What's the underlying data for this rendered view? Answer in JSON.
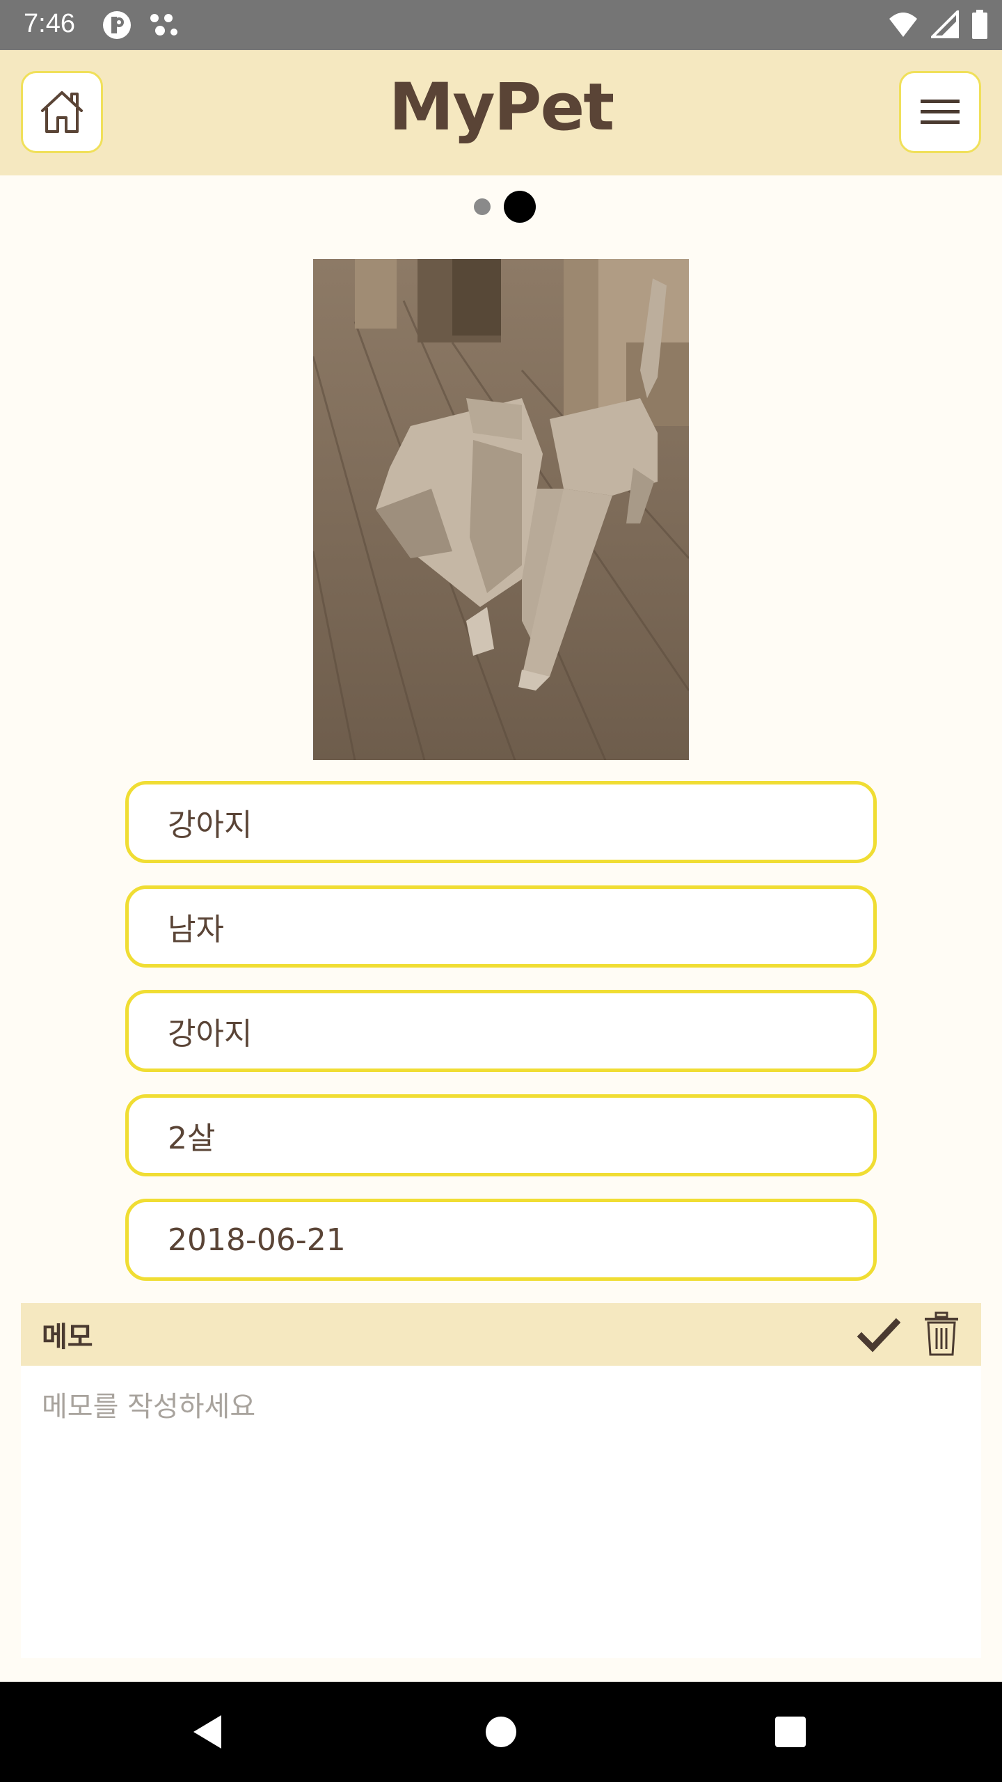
{
  "status_bar": {
    "time": "7:46",
    "left_icons": [
      "p-badge-icon",
      "dots-icon"
    ],
    "right_icons": [
      "wifi-icon",
      "signal-icon",
      "battery-icon"
    ]
  },
  "app_bar": {
    "title": "MyPet",
    "home_icon": "home-icon",
    "menu_icon": "hamburger-menu-icon"
  },
  "pager": {
    "page_count": 2,
    "current_page": 2
  },
  "pet": {
    "photo": "dog-photo",
    "fields": [
      {
        "name": "pet-name",
        "value": "강아지"
      },
      {
        "name": "pet-gender",
        "value": "남자"
      },
      {
        "name": "pet-type",
        "value": "강아지"
      },
      {
        "name": "pet-age",
        "value": "2살"
      },
      {
        "name": "pet-date",
        "value": "2018-06-21"
      }
    ]
  },
  "memo": {
    "label": "메모",
    "placeholder": "메모를 작성하세요",
    "value": "",
    "save_icon": "checkmark-icon",
    "delete_icon": "trash-icon"
  },
  "nav_bar": {
    "icons": [
      "back-icon",
      "home-circle-icon",
      "recents-square-icon"
    ]
  },
  "colors": {
    "appbar_bg": "#f5e8c0",
    "field_border": "#f0dd33",
    "text_brown": "#5a4436",
    "page_bg": "#fffcf5"
  }
}
